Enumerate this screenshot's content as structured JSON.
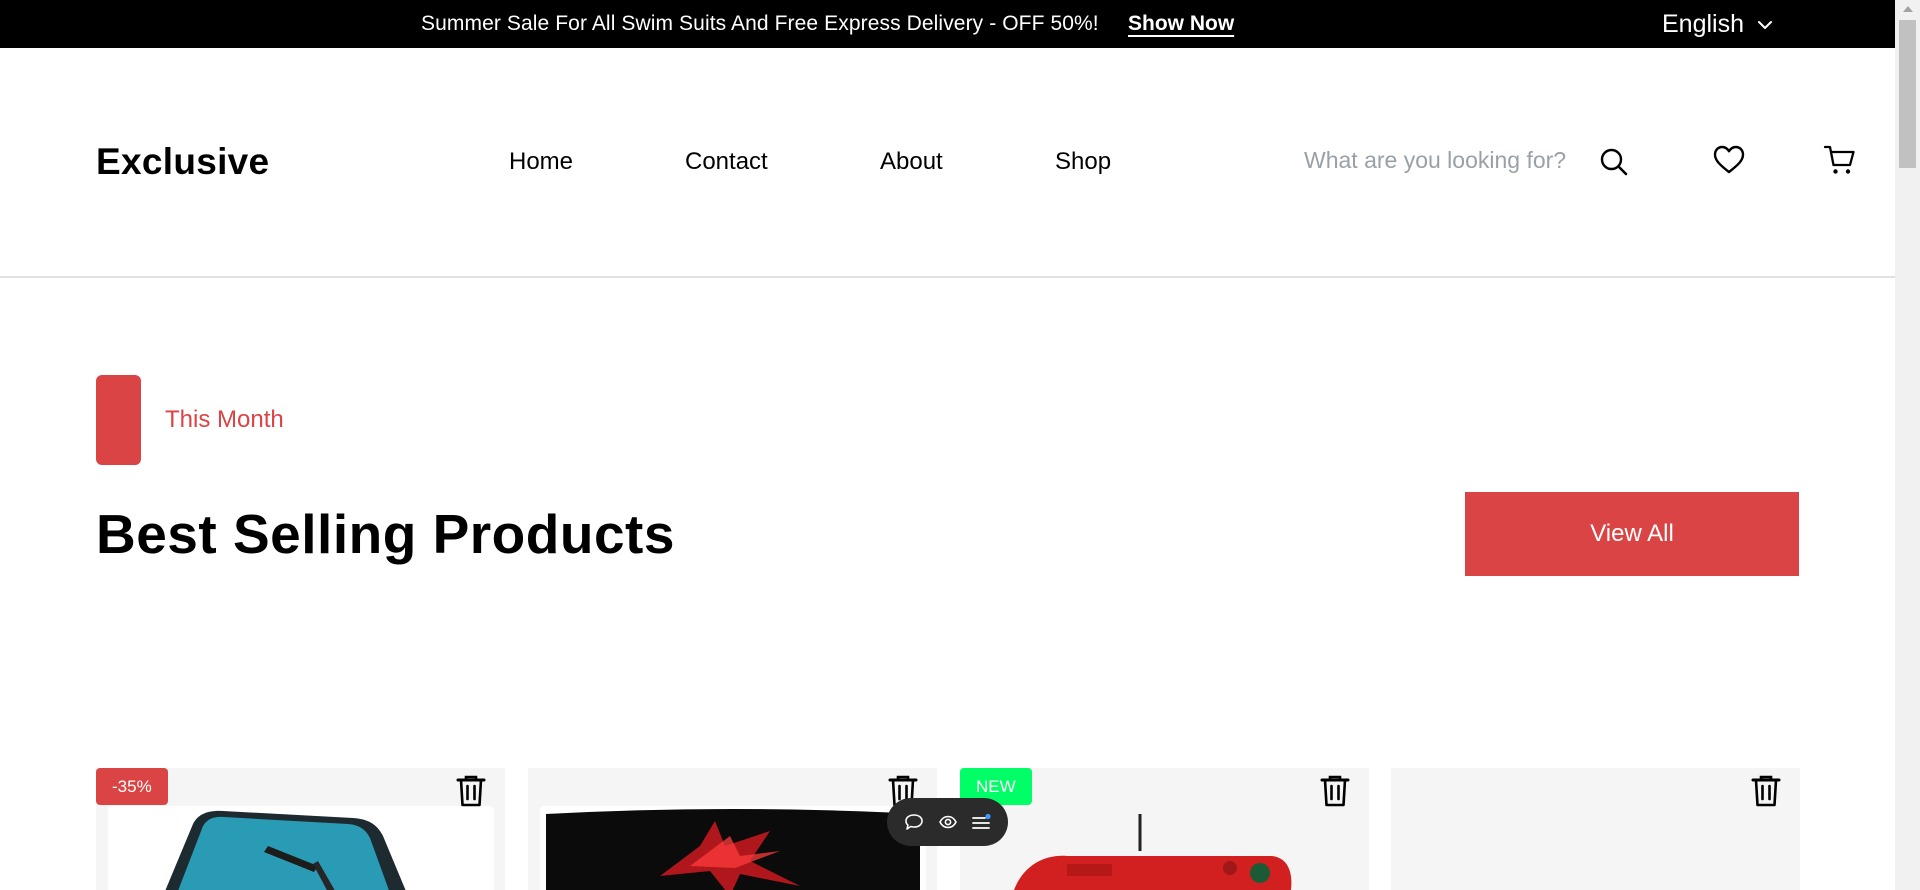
{
  "topbar": {
    "promo_text": "Summer Sale For All Swim Suits And Free Express Delivery - OFF 50%!",
    "shop_link": "Show Now",
    "language": "English"
  },
  "header": {
    "logo": "Exclusive",
    "nav": [
      "Home",
      "Contact",
      "About",
      "Shop"
    ],
    "search_placeholder": "What are you looking for?"
  },
  "section": {
    "label": "This Month",
    "title": "Best Selling Products",
    "view_all": "View All"
  },
  "products": [
    {
      "badge": "-35%",
      "badge_color": "#db4444",
      "image": "laptop"
    },
    {
      "badge": "",
      "image": "monitor"
    },
    {
      "badge": "NEW",
      "badge_color": "#00ff66",
      "image": "gamepad"
    },
    {
      "badge": "",
      "image": "empty"
    }
  ],
  "icons": {
    "search": "search-icon",
    "wishlist": "heart-icon",
    "cart": "cart-icon",
    "language_dropdown": "chevron-down-icon",
    "remove": "trash-icon",
    "toolbar": [
      "comment-icon",
      "eye-icon",
      "menu-icon"
    ]
  },
  "colors": {
    "accent": "#db4444",
    "new_badge": "#00ff66",
    "topbar": "#000000",
    "card_bg": "#f5f5f5"
  }
}
